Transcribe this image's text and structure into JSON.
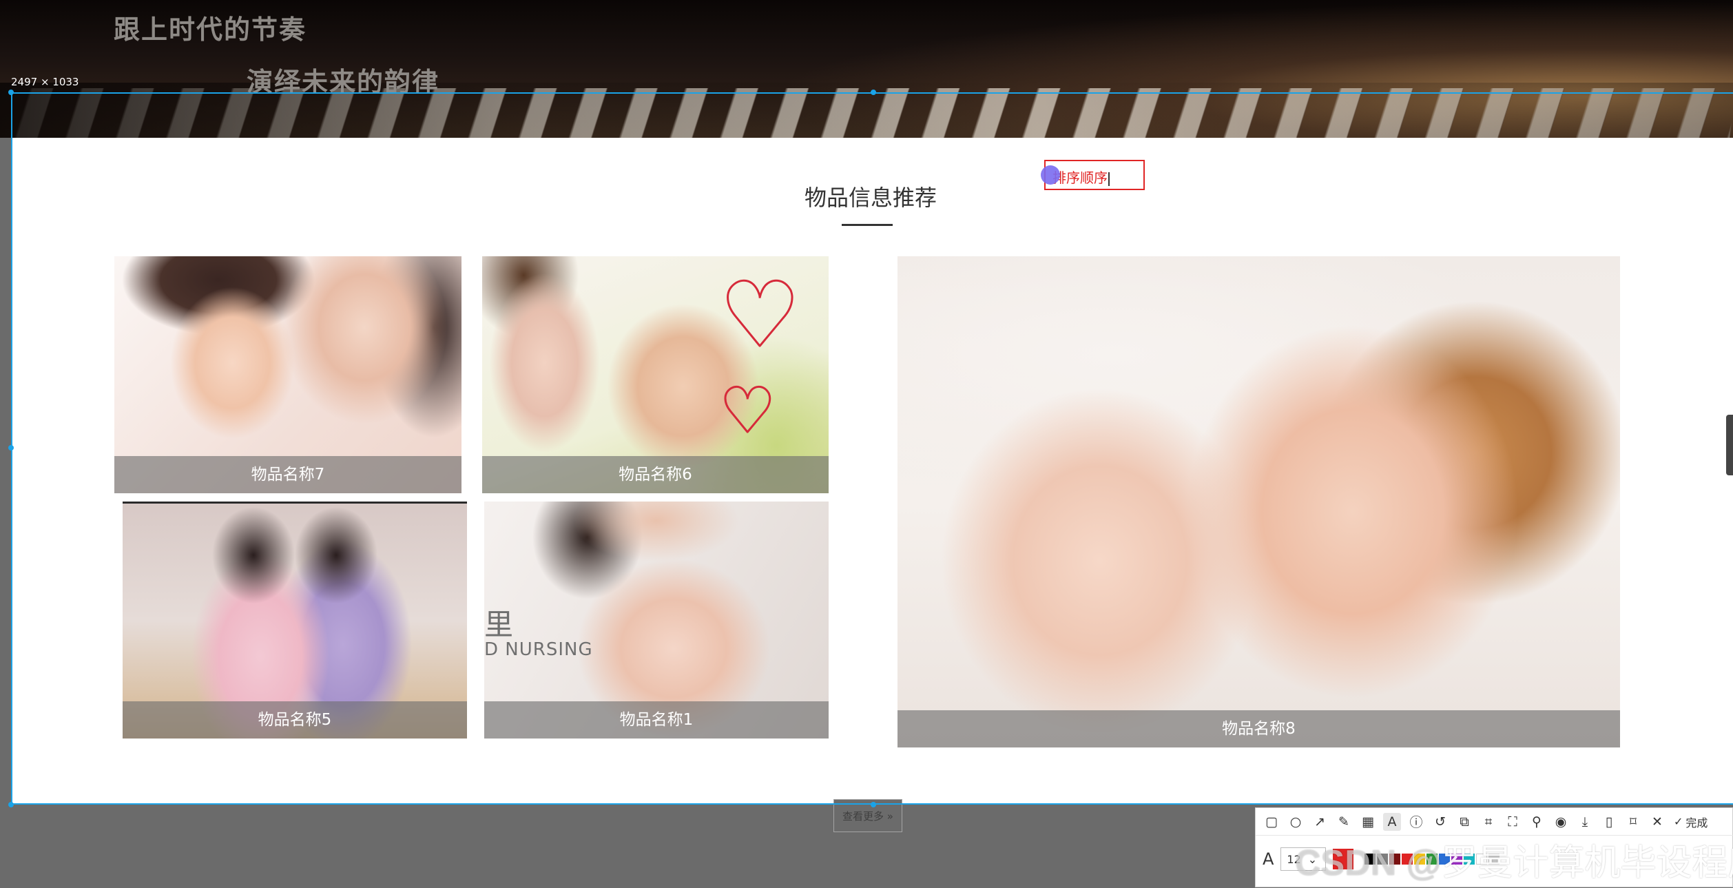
{
  "hero": {
    "slogan_line1": "跟上时代的节奏",
    "slogan_line2": "演绎未来的韵律"
  },
  "selection": {
    "size_label": "2497 × 1033",
    "frame_color": "#1aa3e8"
  },
  "section": {
    "title": "物品信息推荐"
  },
  "items": [
    {
      "id": "item7",
      "label": "物品名称7"
    },
    {
      "id": "item6",
      "label": "物品名称6"
    },
    {
      "id": "item5",
      "label": "物品名称5"
    },
    {
      "id": "item1",
      "label": "物品名称1"
    },
    {
      "id": "item8",
      "label": "物品名称8"
    }
  ],
  "photo_text": {
    "nursing": "D NURSING",
    "nursing_char": "里"
  },
  "annotation": {
    "text": "排序顺序",
    "color": "#e02424"
  },
  "more_button": {
    "label": "查看更多 »"
  },
  "toolbar": {
    "tools": [
      "rectangle-icon",
      "ellipse-icon",
      "arrow-icon",
      "pencil-icon",
      "mosaic-icon",
      "text-icon",
      "number-marker-icon",
      "undo-icon",
      "ocr-icon",
      "translate-icon",
      "scroll-capture-icon",
      "pin-icon",
      "record-icon",
      "download-icon",
      "copy-icon",
      "bookmark-icon",
      "close-icon"
    ],
    "done_label": "完成",
    "font_size": "12",
    "active_color": "#e02424",
    "palette": [
      "#000000",
      "#7f7f7f",
      "#7a1010",
      "#e02424",
      "#f2c21a",
      "#2e9a3a",
      "#2a6fd6",
      "#9b2cc4",
      "#14b8c4",
      "#ffffff",
      "#c8c8c8"
    ]
  },
  "watermark": {
    "prefix": "CSDN @",
    "text": "罗曼计算机毕设程序"
  }
}
